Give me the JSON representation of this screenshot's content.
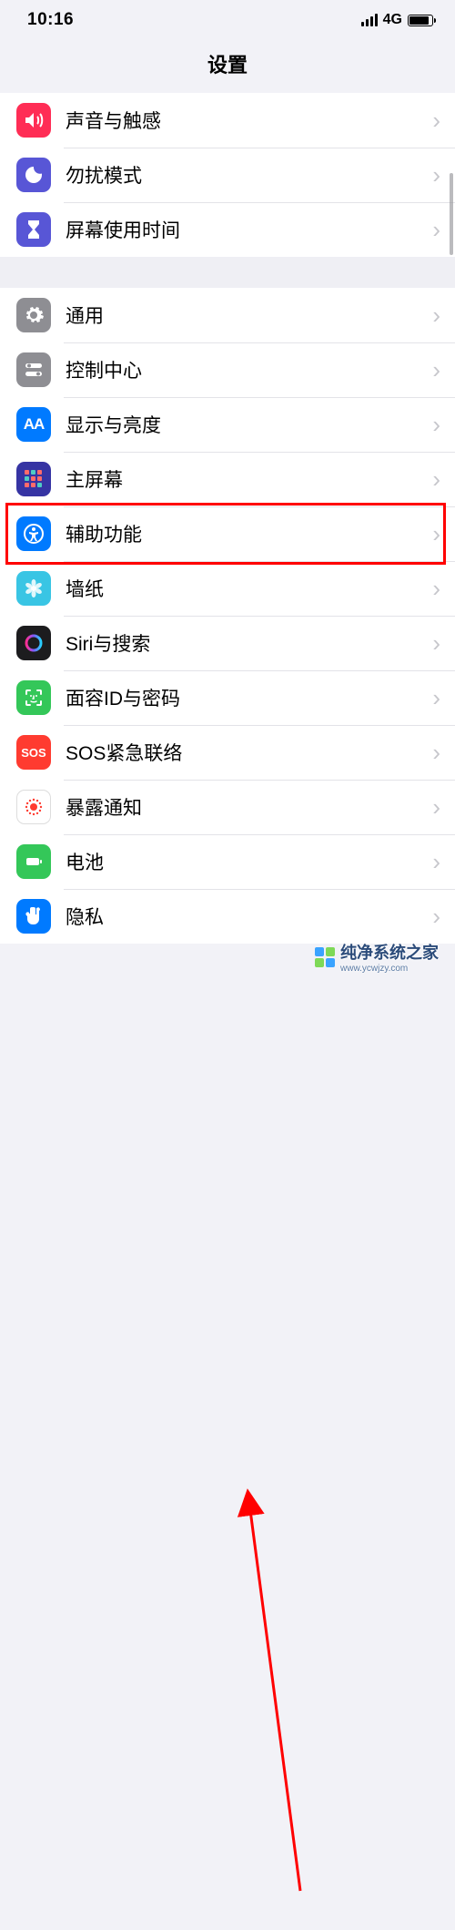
{
  "status": {
    "time": "10:16",
    "network": "4G"
  },
  "header": {
    "title": "设置"
  },
  "groups": [
    {
      "items": [
        {
          "id": "sounds",
          "label": "声音与触感",
          "icon": "speaker",
          "bg": "#ff2d55"
        },
        {
          "id": "dnd",
          "label": "勿扰模式",
          "icon": "moon",
          "bg": "#5856d6"
        },
        {
          "id": "screen-time",
          "label": "屏幕使用时间",
          "icon": "hourglass",
          "bg": "#5856d6"
        }
      ]
    },
    {
      "items": [
        {
          "id": "general",
          "label": "通用",
          "icon": "gear",
          "bg": "#8e8e93"
        },
        {
          "id": "control",
          "label": "控制中心",
          "icon": "toggles",
          "bg": "#8e8e93"
        },
        {
          "id": "display",
          "label": "显示与亮度",
          "icon": "aa",
          "bg": "#007aff"
        },
        {
          "id": "home-screen",
          "label": "主屏幕",
          "icon": "grid",
          "bg": "#3634a3"
        },
        {
          "id": "accessibility",
          "label": "辅助功能",
          "icon": "access",
          "bg": "#007aff",
          "highlight": true
        },
        {
          "id": "wallpaper",
          "label": "墙纸",
          "icon": "flower",
          "bg": "#39c5e4"
        },
        {
          "id": "siri",
          "label": "Siri与搜索",
          "icon": "siri",
          "bg": "#1c1c1e"
        },
        {
          "id": "faceid",
          "label": "面容ID与密码",
          "icon": "faceid",
          "bg": "#34c759"
        },
        {
          "id": "sos",
          "label": "SOS紧急联络",
          "icon": "sos",
          "bg": "#ff3b30"
        },
        {
          "id": "exposure",
          "label": "暴露通知",
          "icon": "exposure",
          "bg": "#ffffff"
        },
        {
          "id": "battery",
          "label": "电池",
          "icon": "battery",
          "bg": "#34c759"
        },
        {
          "id": "privacy",
          "label": "隐私",
          "icon": "hand",
          "bg": "#007aff"
        }
      ]
    }
  ],
  "watermark": {
    "text": "纯净系统之家",
    "url": "www.ycwjzy.com"
  }
}
